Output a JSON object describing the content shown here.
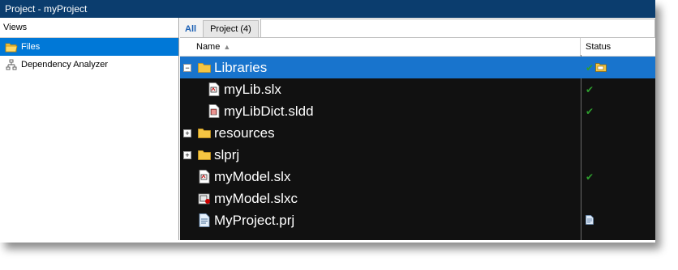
{
  "window": {
    "title": "Project - myProject"
  },
  "views": {
    "header": "Views",
    "items": [
      {
        "label": "Files",
        "icon": "folder-open-icon",
        "selected": true
      },
      {
        "label": "Dependency Analyzer",
        "icon": "dependency-tree-icon",
        "selected": false
      }
    ]
  },
  "tabs": {
    "all_label": "All",
    "project_label": "Project (4)"
  },
  "columns": {
    "name": "Name",
    "status": "Status"
  },
  "files": [
    {
      "name": "Libraries",
      "type": "folder",
      "expanded": true,
      "status": "check-and-folder"
    },
    {
      "name": "myLib.slx",
      "type": "slx-file",
      "child": true,
      "status": "check"
    },
    {
      "name": "myLibDict.sldd",
      "type": "sldd-file",
      "child": true,
      "status": "check"
    },
    {
      "name": "resources",
      "type": "folder",
      "expanded": false,
      "status": ""
    },
    {
      "name": "slprj",
      "type": "folder",
      "expanded": false,
      "status": ""
    },
    {
      "name": "myModel.slx",
      "type": "slx-file",
      "status": "check"
    },
    {
      "name": "myModel.slxc",
      "type": "slxc-file",
      "status": ""
    },
    {
      "name": "MyProject.prj",
      "type": "prj-file",
      "status": "document"
    }
  ],
  "colors": {
    "selection": "#1874cd",
    "titlebar": "#0b3d6e",
    "folder": "#f5c542",
    "check": "#2e9e2e"
  }
}
